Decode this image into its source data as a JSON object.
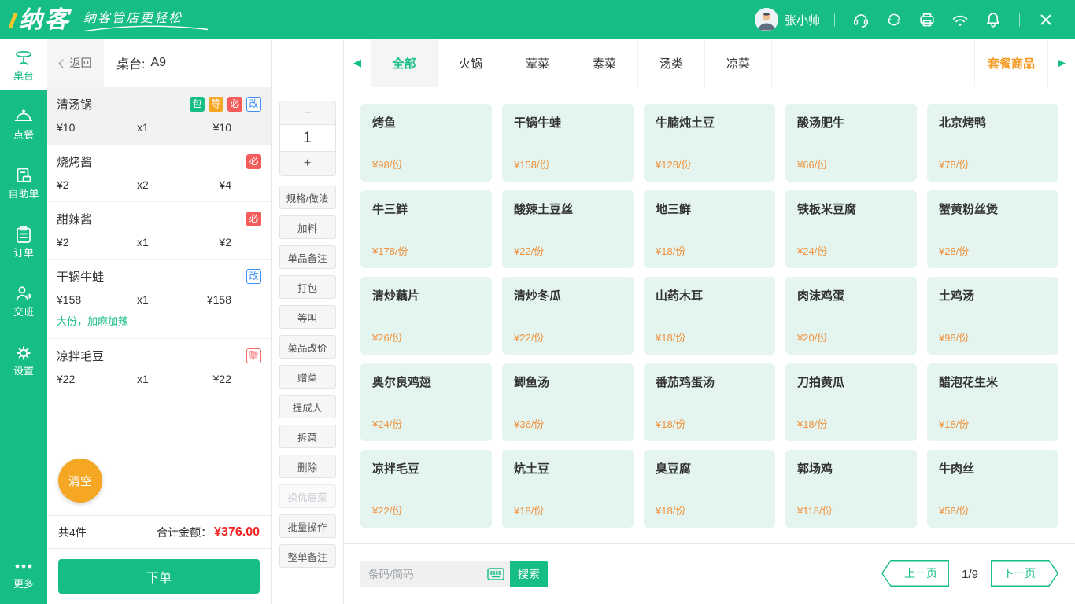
{
  "colors": {
    "primary_green": "#16BD85",
    "accent_orange": "#F5A623",
    "price_orange": "#F0913C",
    "combo_orange": "#F59A23",
    "total_red": "#F42121",
    "badge_red": "#F45B5B",
    "badge_blue": "#3D8EF7",
    "card_mint": "#E3F5EE"
  },
  "header": {
    "logo_text": "纳客",
    "slogan": "纳客管店更轻松",
    "user_name": "张小帅",
    "icons": [
      "customer-service",
      "sync",
      "printer",
      "wifi",
      "notification",
      "close"
    ]
  },
  "sidebar": {
    "items": [
      {
        "label": "桌台",
        "active": true
      },
      {
        "label": "点餐"
      },
      {
        "label": "自助单"
      },
      {
        "label": "订单"
      },
      {
        "label": "交班"
      },
      {
        "label": "设置"
      }
    ],
    "more_label": "更多"
  },
  "order_panel": {
    "back_label": "返回",
    "table_label": "桌台:",
    "table_no": "A9",
    "items": [
      {
        "name": "清汤锅",
        "badges": [
          {
            "text": "包",
            "type": "green"
          },
          {
            "text": "等",
            "type": "orange"
          },
          {
            "text": "必",
            "type": "red"
          },
          {
            "text": "改",
            "type": "blue-outline"
          }
        ],
        "price": "¥10",
        "qty": "x1",
        "total": "¥10",
        "selected": true
      },
      {
        "name": "烧烤酱",
        "badges": [
          {
            "text": "必",
            "type": "red"
          }
        ],
        "price": "¥2",
        "qty": "x2",
        "total": "¥4"
      },
      {
        "name": "甜辣酱",
        "badges": [
          {
            "text": "必",
            "type": "red"
          }
        ],
        "price": "¥2",
        "qty": "x1",
        "total": "¥2"
      },
      {
        "name": "干锅牛蛙",
        "badges": [
          {
            "text": "改",
            "type": "blue-outline"
          }
        ],
        "price": "¥158",
        "qty": "x1",
        "total": "¥158",
        "note": "大份，加麻加辣"
      },
      {
        "name": "凉拌毛豆",
        "badges": [
          {
            "text": "赠",
            "type": "pink-outline"
          }
        ],
        "price": "¥22",
        "qty": "x1",
        "total": "¥22"
      }
    ],
    "clear_label": "清空",
    "summary": {
      "count": "共4件",
      "total_label": "合计金额：",
      "total_value": "¥376.00"
    },
    "submit_label": "下单"
  },
  "actions": {
    "minus_label": "−",
    "qty_value": "1",
    "plus_label": "+",
    "buttons": [
      {
        "label": "规格/做法"
      },
      {
        "label": "加料"
      },
      {
        "label": "单品备注"
      },
      {
        "label": "打包"
      },
      {
        "label": "等叫"
      },
      {
        "label": "菜品改价"
      },
      {
        "label": "赠菜"
      },
      {
        "label": "提成人"
      },
      {
        "label": "拆菜"
      },
      {
        "label": "删除"
      },
      {
        "label": "换优惠菜",
        "disabled": true
      },
      {
        "label": "批量操作"
      },
      {
        "label": "整单备注"
      }
    ]
  },
  "categories": {
    "tabs": [
      {
        "label": "全部",
        "active": true
      },
      {
        "label": "火锅"
      },
      {
        "label": "荤菜"
      },
      {
        "label": "素菜"
      },
      {
        "label": "汤类"
      },
      {
        "label": "凉菜"
      }
    ],
    "combo_label": "套餐商品"
  },
  "menu": {
    "items": [
      {
        "name": "烤鱼",
        "price": "¥98/份"
      },
      {
        "name": "干锅牛蛙",
        "price": "¥158/份"
      },
      {
        "name": "牛腩炖土豆",
        "price": "¥128/份"
      },
      {
        "name": "酸汤肥牛",
        "price": "¥66/份"
      },
      {
        "name": "北京烤鸭",
        "price": "¥78/份"
      },
      {
        "name": "牛三鲜",
        "price": "¥178/份"
      },
      {
        "name": "酸辣土豆丝",
        "price": "¥22/份"
      },
      {
        "name": "地三鲜",
        "price": "¥18/份"
      },
      {
        "name": "铁板米豆腐",
        "price": "¥24/份"
      },
      {
        "name": "蟹黄粉丝煲",
        "price": "¥28/份"
      },
      {
        "name": "清炒藕片",
        "price": "¥26/份"
      },
      {
        "name": "清炒冬瓜",
        "price": "¥22/份"
      },
      {
        "name": "山药木耳",
        "price": "¥18/份"
      },
      {
        "name": "肉沫鸡蛋",
        "price": "¥20/份"
      },
      {
        "name": "土鸡汤",
        "price": "¥98/份"
      },
      {
        "name": "奥尔良鸡翅",
        "price": "¥24/份"
      },
      {
        "name": "鲫鱼汤",
        "price": "¥36/份"
      },
      {
        "name": "番茄鸡蛋汤",
        "price": "¥18/份"
      },
      {
        "name": "刀拍黄瓜",
        "price": "¥18/份"
      },
      {
        "name": "醋泡花生米",
        "price": "¥18/份"
      },
      {
        "name": "凉拌毛豆",
        "price": "¥22/份"
      },
      {
        "name": "炕土豆",
        "price": "¥18/份"
      },
      {
        "name": "臭豆腐",
        "price": "¥18/份"
      },
      {
        "name": "郭场鸡",
        "price": "¥118/份"
      },
      {
        "name": "牛肉丝",
        "price": "¥58/份"
      }
    ]
  },
  "footer": {
    "search_placeholder": "条码/简码",
    "search_label": "搜索",
    "prev_label": "上一页",
    "page_indicator": "1/9",
    "next_label": "下一页"
  }
}
